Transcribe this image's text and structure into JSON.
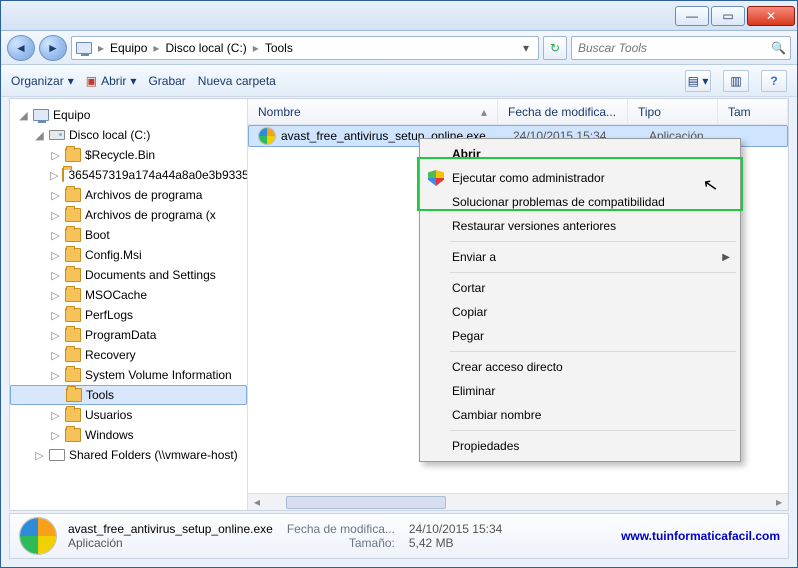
{
  "titlebar": {
    "min": "—",
    "max": "▭",
    "close": "✕"
  },
  "nav": {
    "back": "◄",
    "fwd": "►"
  },
  "breadcrumb": {
    "root_icon": "computer",
    "parts": [
      "Equipo",
      "Disco local (C:)",
      "Tools"
    ],
    "sep": "▸"
  },
  "search": {
    "placeholder": "Buscar Tools",
    "icon": "🔍"
  },
  "refresh": "↻",
  "toolbar": {
    "organize": "Organizar",
    "open": "Abrir",
    "burn": "Grabar",
    "newfolder": "Nueva carpeta",
    "help": "?"
  },
  "tree": {
    "root": "Equipo",
    "drive": "Disco local (C:)",
    "folders": [
      "$Recycle.Bin",
      "365457319a174a44a8a0e3b9335",
      "Archivos de programa",
      "Archivos de programa (x",
      "Boot",
      "Config.Msi",
      "Documents and Settings",
      "MSOCache",
      "PerfLogs",
      "ProgramData",
      "Recovery",
      "System Volume Information",
      "Tools",
      "Usuarios",
      "Windows"
    ],
    "shared": "Shared Folders (\\\\vmware-host)"
  },
  "columns": {
    "name": "Nombre",
    "date": "Fecha de modifica...",
    "type": "Tipo",
    "size": "Tam"
  },
  "file": {
    "name": "avast_free_antivirus_setup_online.exe",
    "date": "24/10/2015 15:34",
    "type": "Aplicación"
  },
  "context_menu": {
    "open": "Abrir",
    "runas": "Ejecutar como administrador",
    "compat": "Solucionar problemas de compatibilidad",
    "restore": "Restaurar versiones anteriores",
    "sendto": "Enviar a",
    "cut": "Cortar",
    "copy": "Copiar",
    "paste": "Pegar",
    "shortcut": "Crear acceso directo",
    "delete": "Eliminar",
    "rename": "Cambiar nombre",
    "props": "Propiedades"
  },
  "details": {
    "filename": "avast_free_antivirus_setup_online.exe",
    "type": "Aplicación",
    "date_label": "Fecha de modifica...",
    "date": "24/10/2015 15:34",
    "size_label": "Tamaño:",
    "size": "5,42 MB",
    "url": "www.tuinformaticafacil.com"
  }
}
